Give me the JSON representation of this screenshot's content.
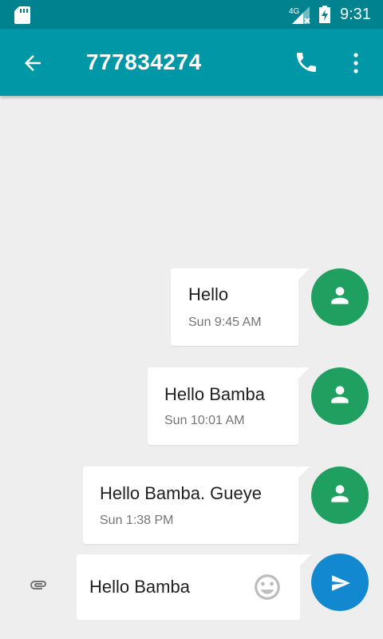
{
  "status_bar": {
    "time": "9:31",
    "network_label": "4G",
    "icons": [
      "sd-card-icon",
      "signal-icon",
      "battery-charging-icon"
    ]
  },
  "app_bar": {
    "title": "777834274",
    "icons": [
      "back-arrow-icon",
      "phone-icon",
      "more-vert-icon"
    ]
  },
  "messages": [
    {
      "text": "Hello",
      "timestamp": "Sun 9:45 AM"
    },
    {
      "text": "Hello Bamba",
      "timestamp": "Sun 10:01 AM"
    },
    {
      "text": "Hello Bamba. Gueye",
      "timestamp": "Sun 1:38 PM"
    }
  ],
  "compose": {
    "value": "Hello Bamba",
    "icons": [
      "paperclip-icon",
      "emoji-icon",
      "send-icon"
    ]
  },
  "colors": {
    "status_bar": "#00838f",
    "app_bar": "#0097a7",
    "avatar": "#1fa060",
    "send_button": "#1188d0",
    "background": "#eeeeee"
  }
}
